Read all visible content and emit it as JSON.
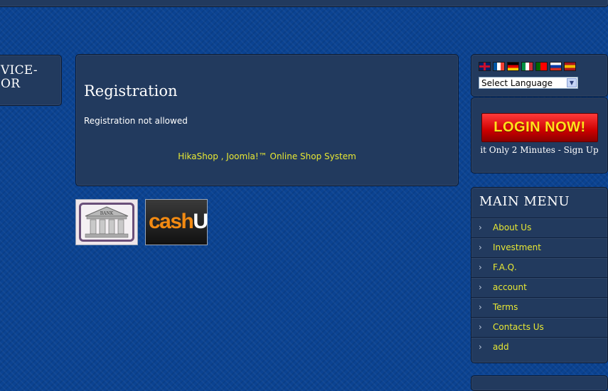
{
  "left_panel": {
    "text_line1": "VICE-",
    "text_line2": "OR"
  },
  "content": {
    "title": "Registration",
    "message": "Registration not allowed",
    "footer_link": "HikaShop , Joomla!™ Online Shop System"
  },
  "payments": {
    "bank_label": "BANK",
    "cashu_part1": "cash",
    "cashu_part2": "U"
  },
  "language": {
    "flags": [
      {
        "name": "uk-flag-icon",
        "colors": [
          "#012169",
          "#c8102e"
        ]
      },
      {
        "name": "france-flag-icon",
        "colors": [
          "#0055a4",
          "#ffffff",
          "#ef4135"
        ]
      },
      {
        "name": "germany-flag-icon",
        "colors": [
          "#000000",
          "#dd0000",
          "#ffce00"
        ]
      },
      {
        "name": "italy-flag-icon",
        "colors": [
          "#009246",
          "#ffffff",
          "#ce2b37"
        ]
      },
      {
        "name": "portugal-flag-icon",
        "colors": [
          "#006600",
          "#ff0000"
        ]
      },
      {
        "name": "russia-flag-icon",
        "colors": [
          "#ffffff",
          "#0039a6",
          "#d52b1e"
        ]
      },
      {
        "name": "spain-flag-icon",
        "colors": [
          "#aa151b",
          "#f1bf00",
          "#aa151b"
        ]
      }
    ],
    "select_value": "Select Language"
  },
  "login": {
    "button_label": "LOGIN NOW!",
    "subtitle": "it Only 2 Minutes - Sign Up"
  },
  "main_menu": {
    "title": "MAIN MENU",
    "items": [
      {
        "label": "About Us"
      },
      {
        "label": "Investment"
      },
      {
        "label": "F.A.Q."
      },
      {
        "label": "account"
      },
      {
        "label": "Terms"
      },
      {
        "label": "Contacts Us"
      },
      {
        "label": "add"
      }
    ]
  },
  "colors": {
    "background": "#0b4392",
    "panel": "#223a5e",
    "link": "#e8e833"
  }
}
